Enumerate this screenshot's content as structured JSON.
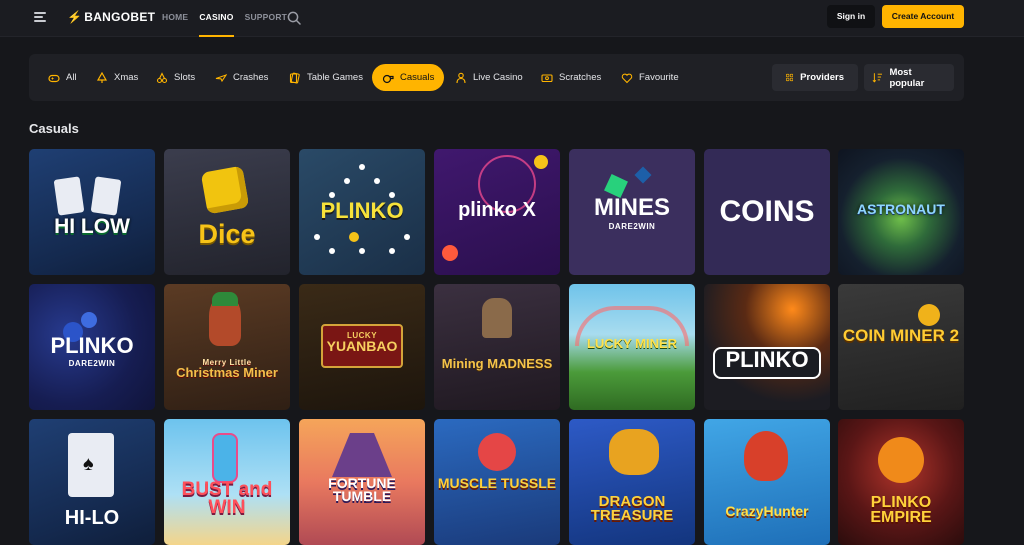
{
  "header": {
    "logo": "BANGOBET",
    "nav": [
      {
        "label": "HOME"
      },
      {
        "label": "CASINO"
      },
      {
        "label": "SUPPORT"
      }
    ],
    "signin_label": "Sign in",
    "create_label": "Create Account"
  },
  "categories": [
    {
      "label": "All",
      "icon": "gamepad-icon"
    },
    {
      "label": "Xmas",
      "icon": "tree-icon"
    },
    {
      "label": "Slots",
      "icon": "cherries-icon"
    },
    {
      "label": "Crashes",
      "icon": "plane-icon"
    },
    {
      "label": "Table Games",
      "icon": "cards-icon"
    },
    {
      "label": "Casuals",
      "icon": "whistle-icon",
      "active": true
    },
    {
      "label": "Live Casino",
      "icon": "dealer-icon"
    },
    {
      "label": "Scratches",
      "icon": "ticket-icon"
    },
    {
      "label": "Favourite",
      "icon": "heart-icon"
    }
  ],
  "toolbar": {
    "providers_label": "Providers",
    "sort_label": "Most popular"
  },
  "section": {
    "title": "Casuals"
  },
  "games": {
    "row1": [
      {
        "title": "HI LOW"
      },
      {
        "title": "Dice"
      },
      {
        "title": "PLINKO"
      },
      {
        "title": "plinko X"
      },
      {
        "title": "MINES",
        "sub": "DARE2WIN"
      },
      {
        "title": "COINS"
      },
      {
        "title": "ASTRONAUT"
      }
    ],
    "row2": [
      {
        "title": "PLINKO",
        "sub": "DARE2WIN"
      },
      {
        "title": "Christmas Miner",
        "sub": "Merry Little"
      },
      {
        "title": "YUANBAO",
        "sub": "LUCKY"
      },
      {
        "title": "Mining MADNESS"
      },
      {
        "title": "LUCKY MINER"
      },
      {
        "title": "PLINKO"
      },
      {
        "title": "COIN MINER 2"
      }
    ],
    "row3": [
      {
        "title": "HI-LO"
      },
      {
        "title": "BUST and WIN"
      },
      {
        "title": "FORTUNE TUMBLE"
      },
      {
        "title": "MUSCLE TUSSLE"
      },
      {
        "title": "DRAGON TREASURE"
      },
      {
        "title": "CrazyHunter"
      },
      {
        "title": "PLINKO EMPIRE"
      }
    ]
  },
  "colors": {
    "accent": "#ffb400",
    "background": "#16171b",
    "panel": "#1f2025"
  }
}
